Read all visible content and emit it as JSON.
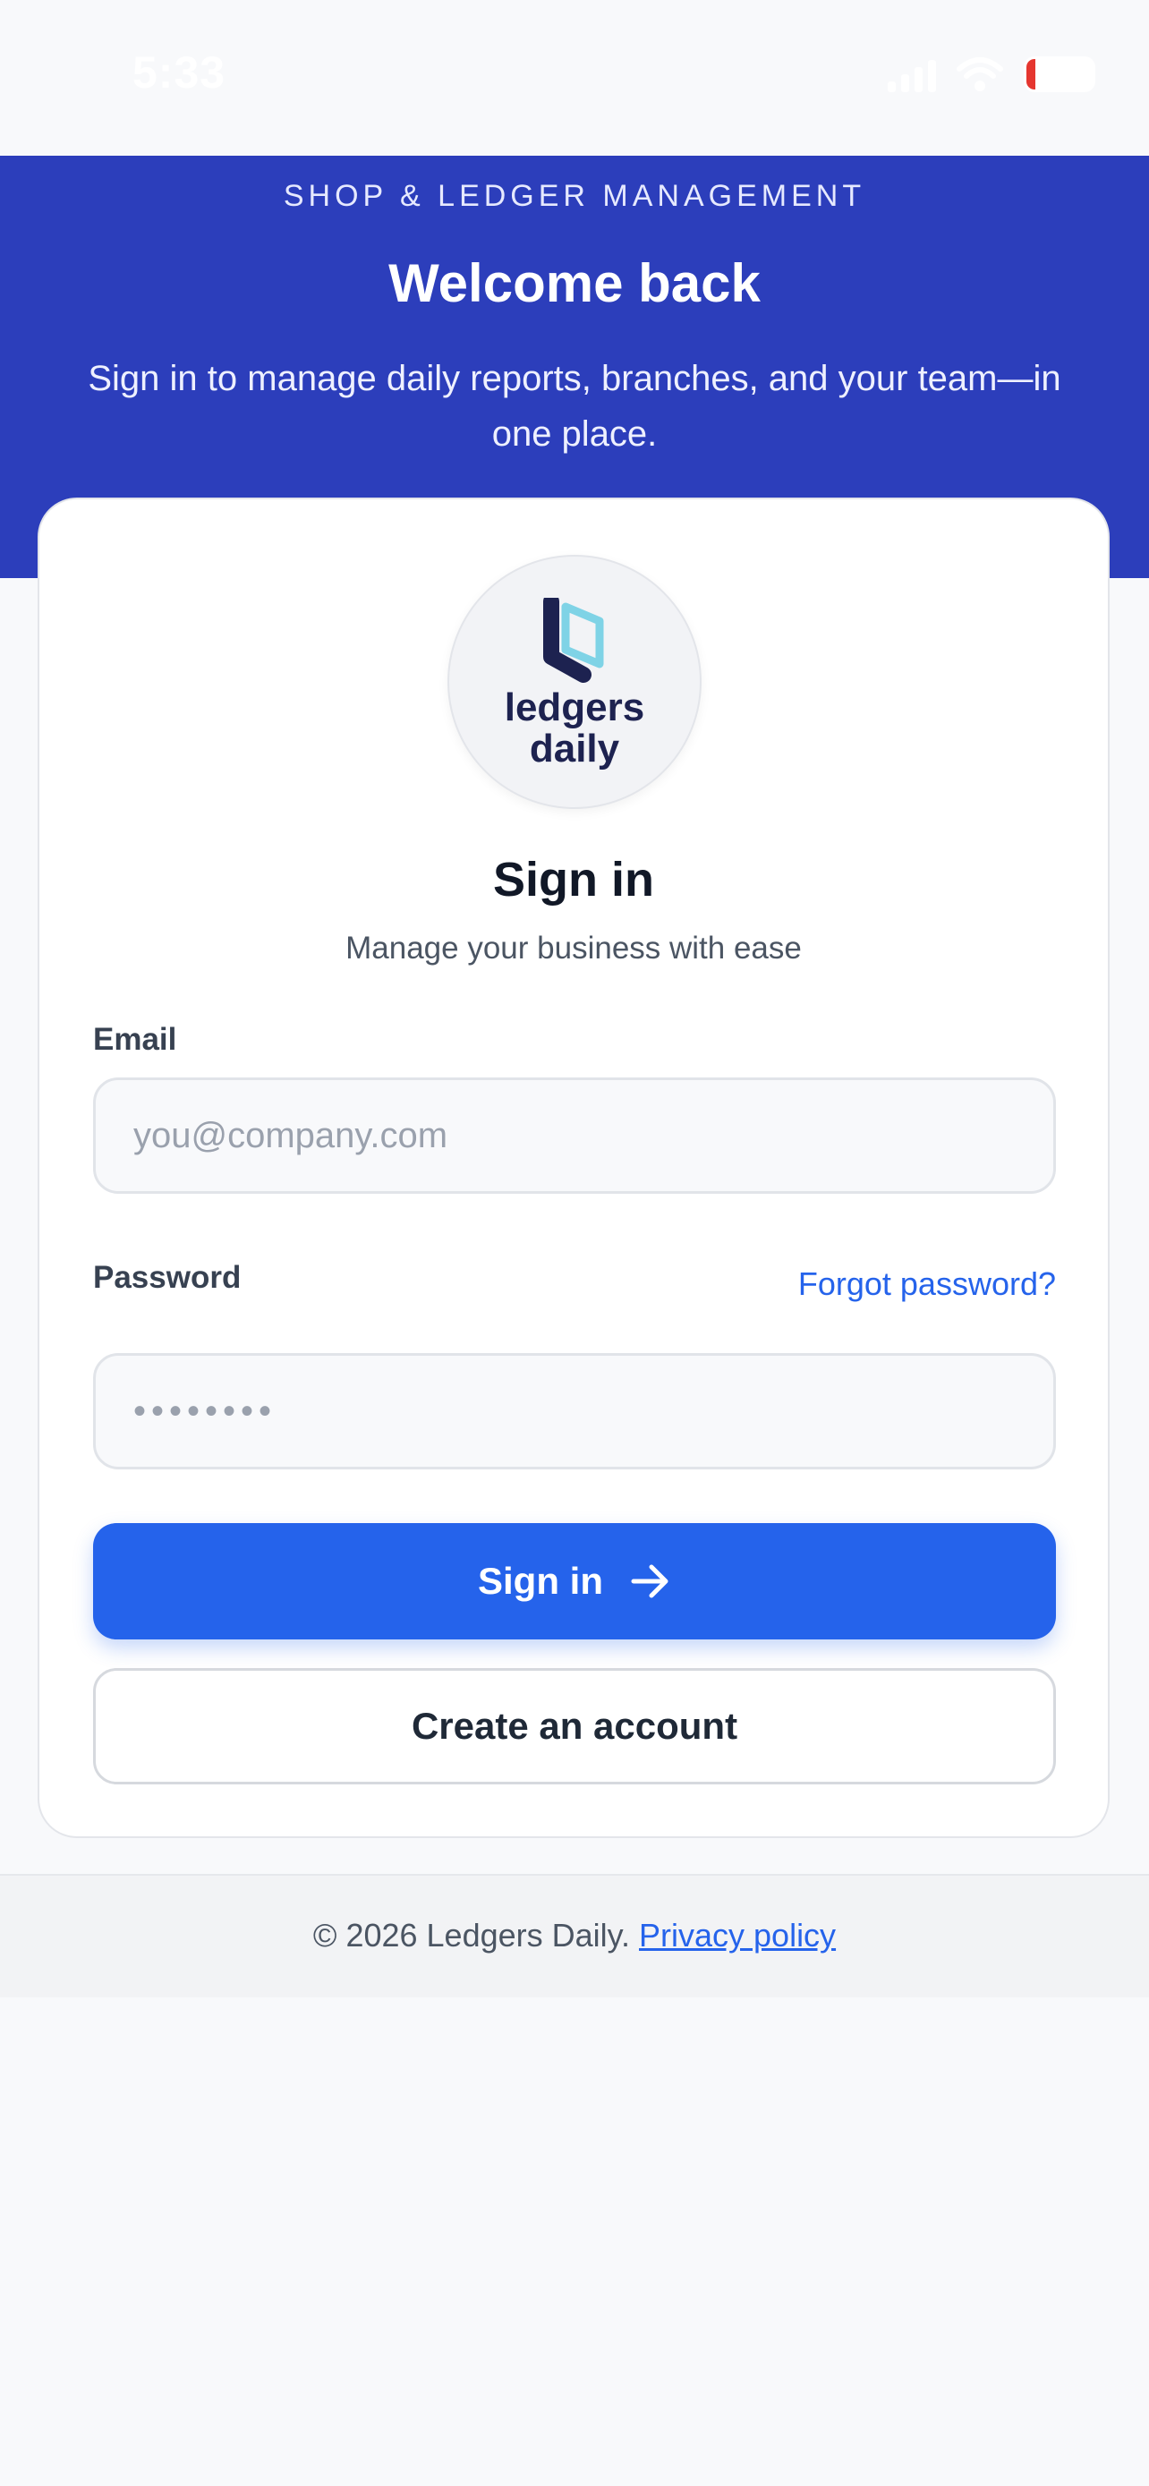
{
  "status_bar": {
    "time": "5:33",
    "battery": "6"
  },
  "hero": {
    "eyebrow": "SHOP & LEDGER MANAGEMENT",
    "title": "Welcome back",
    "subtitle": "Sign in to manage daily reports, branches, and your team—in one place."
  },
  "logo": {
    "line1": "ledgers",
    "line2": "daily"
  },
  "card": {
    "title": "Sign in",
    "subtitle": "Manage your business with ease"
  },
  "form": {
    "email_label": "Email",
    "email_placeholder": "you@company.com",
    "password_label": "Password",
    "password_placeholder": "••••••••",
    "forgot_link": "Forgot password?",
    "sign_in_button": "Sign in",
    "create_account_button": "Create an account"
  },
  "footer": {
    "copyright": "© 2026 Ledgers Daily.",
    "privacy_link": "Privacy policy"
  },
  "colors": {
    "hero": "#2c3ebb",
    "primary": "#2563eb",
    "logo_dark": "#1d2250",
    "logo_accent": "#7fd3e6"
  }
}
